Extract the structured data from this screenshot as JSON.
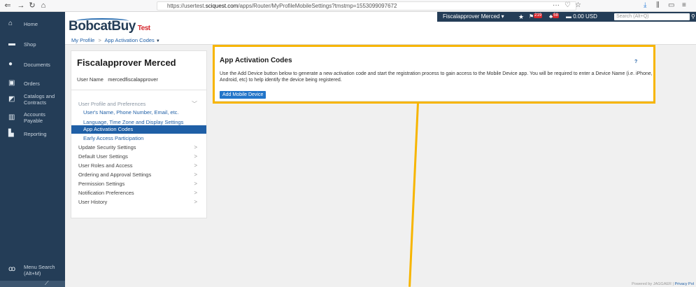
{
  "browser": {
    "url_prefix": "https://usertest.",
    "url_domain": "sciquest.com",
    "url_suffix": "/apps/Router/MyProfileMobileSettings?tmstmp=1553099097672",
    "more": "···"
  },
  "sidebar": {
    "items": [
      {
        "label": "Home",
        "icon": "home-icon"
      },
      {
        "label": "Shop",
        "icon": "cart-icon"
      },
      {
        "label": "Documents",
        "icon": "documents-icon"
      },
      {
        "label": "Orders",
        "icon": "orders-icon"
      },
      {
        "label": "Catalogs and Contracts",
        "icon": "catalog-icon"
      },
      {
        "label": "Accounts Payable",
        "icon": "bank-icon"
      },
      {
        "label": "Reporting",
        "icon": "chart-icon"
      }
    ],
    "menu_search": "Menu Search",
    "menu_search_shortcut": "(Alt+M)"
  },
  "header": {
    "logo": "BobcatBuy",
    "logo_tag": "Test",
    "user_menu": "Fiscalapprover Merced ▾",
    "flag_count": "219",
    "alert_count": "58",
    "cart_total": "0.00 USD",
    "search_placeholder": "Search (Alt+Q)"
  },
  "breadcrumb": {
    "root": "My Profile",
    "separator": ">",
    "current": "App Activation Codes"
  },
  "profile": {
    "name": "Fiscalapprover Merced",
    "user_name_label": "User Name",
    "user_name_value": "mercedfiscalapprover",
    "menu": [
      {
        "label": "User Profile and Preferences",
        "type": "top-muted",
        "arrow": "﹀"
      },
      {
        "label": "User's Name, Phone Number, Email, etc.",
        "type": "sub"
      },
      {
        "label": "Language, Time Zone and Display Settings",
        "type": "sub"
      },
      {
        "label": "App Activation Codes",
        "type": "active"
      },
      {
        "label": "Early Access Participation",
        "type": "sub"
      },
      {
        "label": "Update Security Settings",
        "type": "top",
        "arrow": ">"
      },
      {
        "label": "Default User Settings",
        "type": "top",
        "arrow": ">"
      },
      {
        "label": "User Roles and Access",
        "type": "top",
        "arrow": ">"
      },
      {
        "label": "Ordering and Approval Settings",
        "type": "top",
        "arrow": ">"
      },
      {
        "label": "Permission Settings",
        "type": "top",
        "arrow": ">"
      },
      {
        "label": "Notification Preferences",
        "type": "top",
        "arrow": ">"
      },
      {
        "label": "User History",
        "type": "top",
        "arrow": ">"
      }
    ]
  },
  "main": {
    "title": "App Activation Codes",
    "help": "?",
    "description": "Use the Add Device button below to generate a new activation code and start the registration process to gain access to the Mobile Device app. You will be required to enter a Device Name (i.e. iPhone, Android, etc) to help identify the device being registered.",
    "add_button": "Add Mobile Device"
  },
  "footer": {
    "powered": "Powered by JAGGAER |",
    "privacy": "Privacy Pol"
  },
  "colors": {
    "sidebar": "#243d57",
    "accent": "#1f5fa6",
    "highlight": "#f7b500",
    "logo_test": "#d6282e"
  }
}
